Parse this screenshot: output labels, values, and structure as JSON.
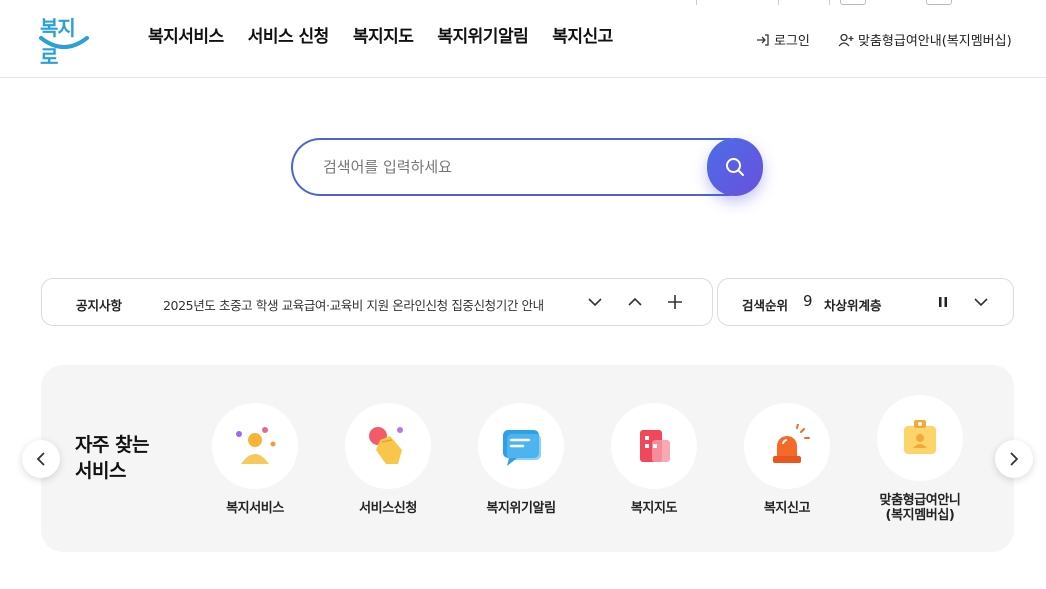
{
  "header": {
    "logo_text": "복지로",
    "nav": [
      "복지서비스",
      "서비스 신청",
      "복지지도",
      "복지위기알림",
      "복지신고"
    ],
    "login_label": "로그인",
    "member_label": "맞춤형급여안내(복지멤버십)"
  },
  "search": {
    "placeholder": "검색어를 입력하세요"
  },
  "notice": {
    "label": "공지사항",
    "text": "2025년도 초중고 학생 교육급여·교육비 지원 온라인신청 집중신청기간 안내"
  },
  "ranking": {
    "label": "검색순위",
    "rank": "9",
    "keyword": "차상위계층"
  },
  "favorites": {
    "title_line1": "자주 찾는",
    "title_line2": "서비스",
    "items": [
      {
        "label": "복지서비스",
        "icon": "person-icon"
      },
      {
        "label": "서비스신청",
        "icon": "hand-pointer-icon"
      },
      {
        "label": "복지위기알림",
        "icon": "message-icon"
      },
      {
        "label": "복지지도",
        "icon": "map-icon"
      },
      {
        "label": "복지신고",
        "icon": "siren-icon"
      },
      {
        "label": "맞춤형급여안니\n(복지멤버십)",
        "line1": "맞춤형급여안니",
        "line2": "(복지멤버십)",
        "icon": "id-badge-icon"
      }
    ]
  },
  "colors": {
    "accent": "#4a64d8",
    "logo": "#2a9fd8",
    "panel_bg": "#f5f5f5"
  }
}
